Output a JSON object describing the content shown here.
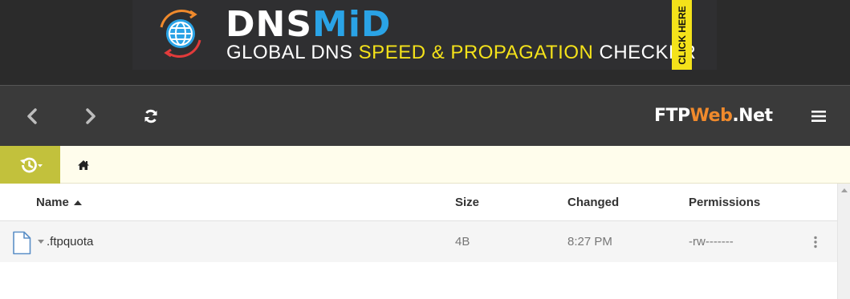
{
  "ad": {
    "brand_part1": "DNS",
    "brand_part2": "MiD",
    "tagline_part1": "GLOBAL DNS ",
    "tagline_highlight": "SPEED & PROPAGATION",
    "tagline_part2": " CHECKER",
    "cta": "CLICK HERE",
    "colors": {
      "background": "#2f2f31",
      "brand_blue": "#2aa3e6",
      "highlight_yellow": "#f4e21a",
      "globe_orange": "#f08a2c",
      "globe_red": "#e23b3b"
    }
  },
  "toolbar": {
    "back_icon": "chevron-left-icon",
    "forward_icon": "chevron-right-icon",
    "refresh_icon": "refresh-icon",
    "menu_icon": "hamburger-menu-icon",
    "logo_part1": "FTP",
    "logo_part2": "Web",
    "logo_part3": ".Net",
    "colors": {
      "background": "#3a3a3a",
      "logo_accent": "#f08a2c"
    }
  },
  "breadcrumb": {
    "history_icon": "history-icon",
    "home_icon": "home-icon",
    "colors": {
      "bar_background": "#fffdec",
      "history_button": "#c2c13c"
    }
  },
  "table": {
    "columns": {
      "name": "Name",
      "size": "Size",
      "changed": "Changed",
      "permissions": "Permissions"
    },
    "sort": {
      "column": "name",
      "direction": "ascending"
    },
    "rows": [
      {
        "name": ".ftpquota",
        "size": "4B",
        "changed": "8:27 PM",
        "permissions": "-rw-------",
        "icon": "file-icon"
      }
    ]
  }
}
